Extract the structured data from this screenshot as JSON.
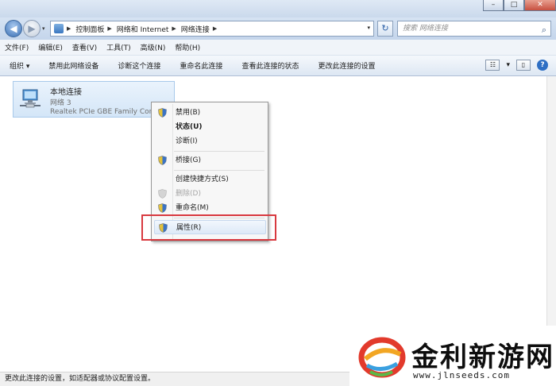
{
  "window": {
    "minimize_glyph": "–",
    "maximize_glyph": "□",
    "close_glyph": "✕"
  },
  "address_bar": {
    "breadcrumbs": [
      "控制面板",
      "网络和 Internet",
      "网络连接"
    ],
    "search_placeholder": "搜索 网络连接"
  },
  "menu_bar": {
    "items": [
      "文件(F)",
      "编辑(E)",
      "查看(V)",
      "工具(T)",
      "高级(N)",
      "帮助(H)"
    ]
  },
  "command_bar": {
    "items": [
      "组织 ▾",
      "禁用此网络设备",
      "诊断这个连接",
      "重命名此连接",
      "查看此连接的状态",
      "更改此连接的设置"
    ]
  },
  "connection": {
    "name": "本地连接",
    "network": "网络  3",
    "device": "Realtek PCIe GBE Family Controller"
  },
  "context_menu": {
    "items": [
      {
        "label": "禁用(B)",
        "icon": "shield-icon"
      },
      {
        "label": "状态(U)",
        "bold": true
      },
      {
        "label": "诊断(I)"
      },
      {
        "label": "桥接(G)",
        "icon": "shield-icon"
      },
      {
        "label": "创建快捷方式(S)"
      },
      {
        "label": "删除(D)",
        "icon": "shield-icon",
        "disabled": true
      },
      {
        "label": "重命名(M)",
        "icon": "shield-icon"
      },
      {
        "label": "属性(R)",
        "icon": "shield-icon",
        "highlighted": true
      }
    ]
  },
  "status_bar": {
    "text": "更改此连接的设置，如适配器或协议配置设置。"
  },
  "watermark": {
    "title": "金利新游网",
    "url": "www.jlnseeds.com"
  },
  "colors": {
    "highlight_frame": "#d8393f",
    "tile_background": "#d4e6f8"
  }
}
